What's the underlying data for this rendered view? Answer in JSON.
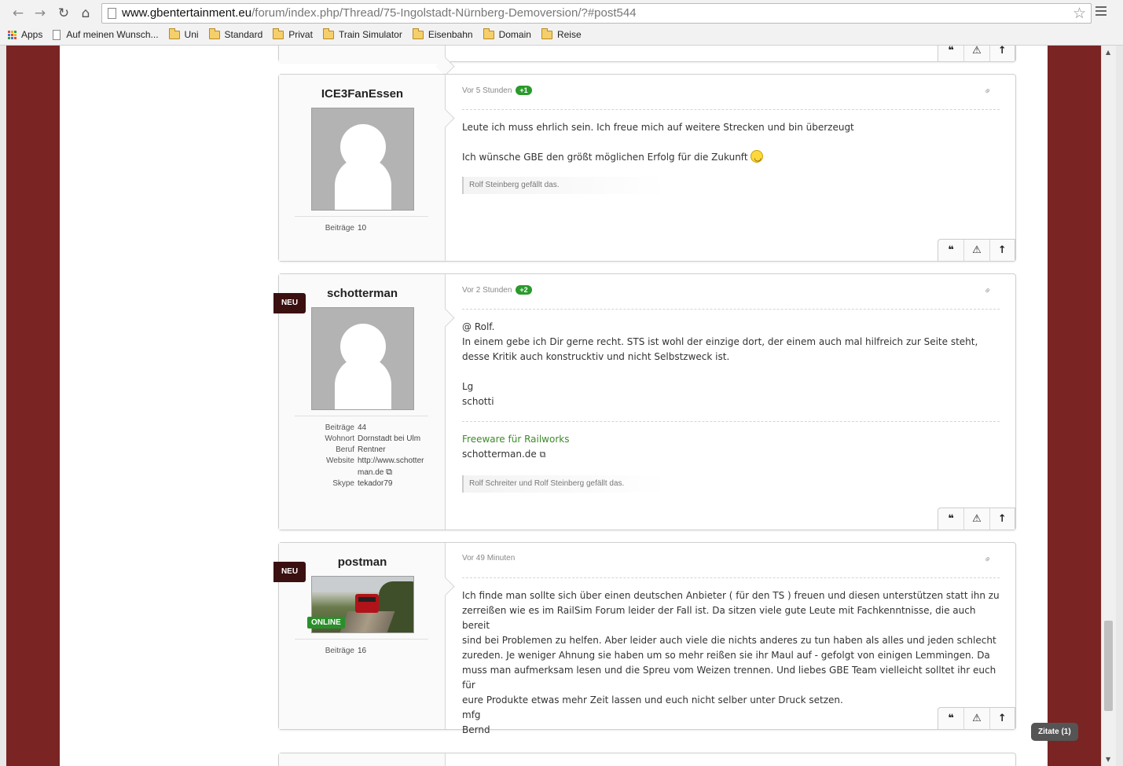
{
  "browser": {
    "url_host": "www.gbentertainment.eu",
    "url_path": "/forum/index.php/Thread/75-Ingolstadt-Nürnberg-Demoversion/?#post544",
    "bookmarks": [
      "Apps",
      "Auf meinen Wunsch...",
      "Uni",
      "Standard",
      "Privat",
      "Train Simulator",
      "Eisenbahn",
      "Domain",
      "Reise"
    ]
  },
  "colors": {
    "frame": "#7a2424",
    "badge_green": "#2a9a2a",
    "neu_badge": "#3b1010"
  },
  "posts": [
    {
      "username": "ICE3FanEssen",
      "time": "Vor 5 Stunden",
      "likes_badge": "+1",
      "info": [
        {
          "k": "Beiträge",
          "v": "10"
        }
      ],
      "body": [
        "Leute ich muss ehrlich sein. Ich freue mich auf weitere Strecken und bin überzeugt",
        "Ich wünsche GBE den größt möglichen Erfolg für die Zukunft"
      ],
      "liked_by": "Rolf Steinberg gefällt das."
    },
    {
      "username": "schotterman",
      "badge": "NEU",
      "time": "Vor 2 Stunden",
      "likes_badge": "+2",
      "info": [
        {
          "k": "Beiträge",
          "v": "44"
        },
        {
          "k": "Wohnort",
          "v": "Dornstadt bei Ulm"
        },
        {
          "k": "Beruf",
          "v": "Rentner"
        },
        {
          "k": "Website",
          "v": "http://www.schotterman.de"
        },
        {
          "k": "Skype",
          "v": "tekador79"
        }
      ],
      "body": [
        "@ Rolf.",
        "In einem gebe ich Dir gerne recht. STS ist wohl der einzige dort, der einem auch mal hilfreich zur Seite steht,",
        "desse Kritik auch konstrucktiv und nicht Selbstzweck ist.",
        "Lg",
        "schotti"
      ],
      "signature_title": "Freeware für Railworks",
      "signature_link": "schotterman.de",
      "liked_by": "Rolf Schreiter und Rolf Steinberg gefällt das."
    },
    {
      "username": "postman",
      "badge": "NEU",
      "status": "ONLINE",
      "time": "Vor 49 Minuten",
      "info": [
        {
          "k": "Beiträge",
          "v": "16"
        }
      ],
      "body": [
        "Ich finde man sollte sich über einen deutschen Anbieter ( für den TS ) freuen und diesen unterstützen statt ihn zu",
        "zerreißen wie es im RailSim Forum leider der Fall ist. Da sitzen viele gute Leute mit Fachkenntnisse, die auch bereit",
        "sind bei Problemen zu helfen. Aber leider auch viele die nichts anderes zu tun haben als alles und jeden schlecht",
        "zureden. Je weniger Ahnung sie haben um so mehr reißen sie ihr Maul auf - gefolgt von einigen Lemmingen. Da",
        "muss man aufmerksam lesen und die Spreu vom Weizen trennen. Und liebes GBE Team vielleicht solltet ihr euch für",
        "eure Produkte etwas mehr Zeit lassen und euch nicht selber unter Druck setzen.",
        "mfg",
        "Bernd"
      ]
    }
  ],
  "quote_button": "Zitate (1)"
}
